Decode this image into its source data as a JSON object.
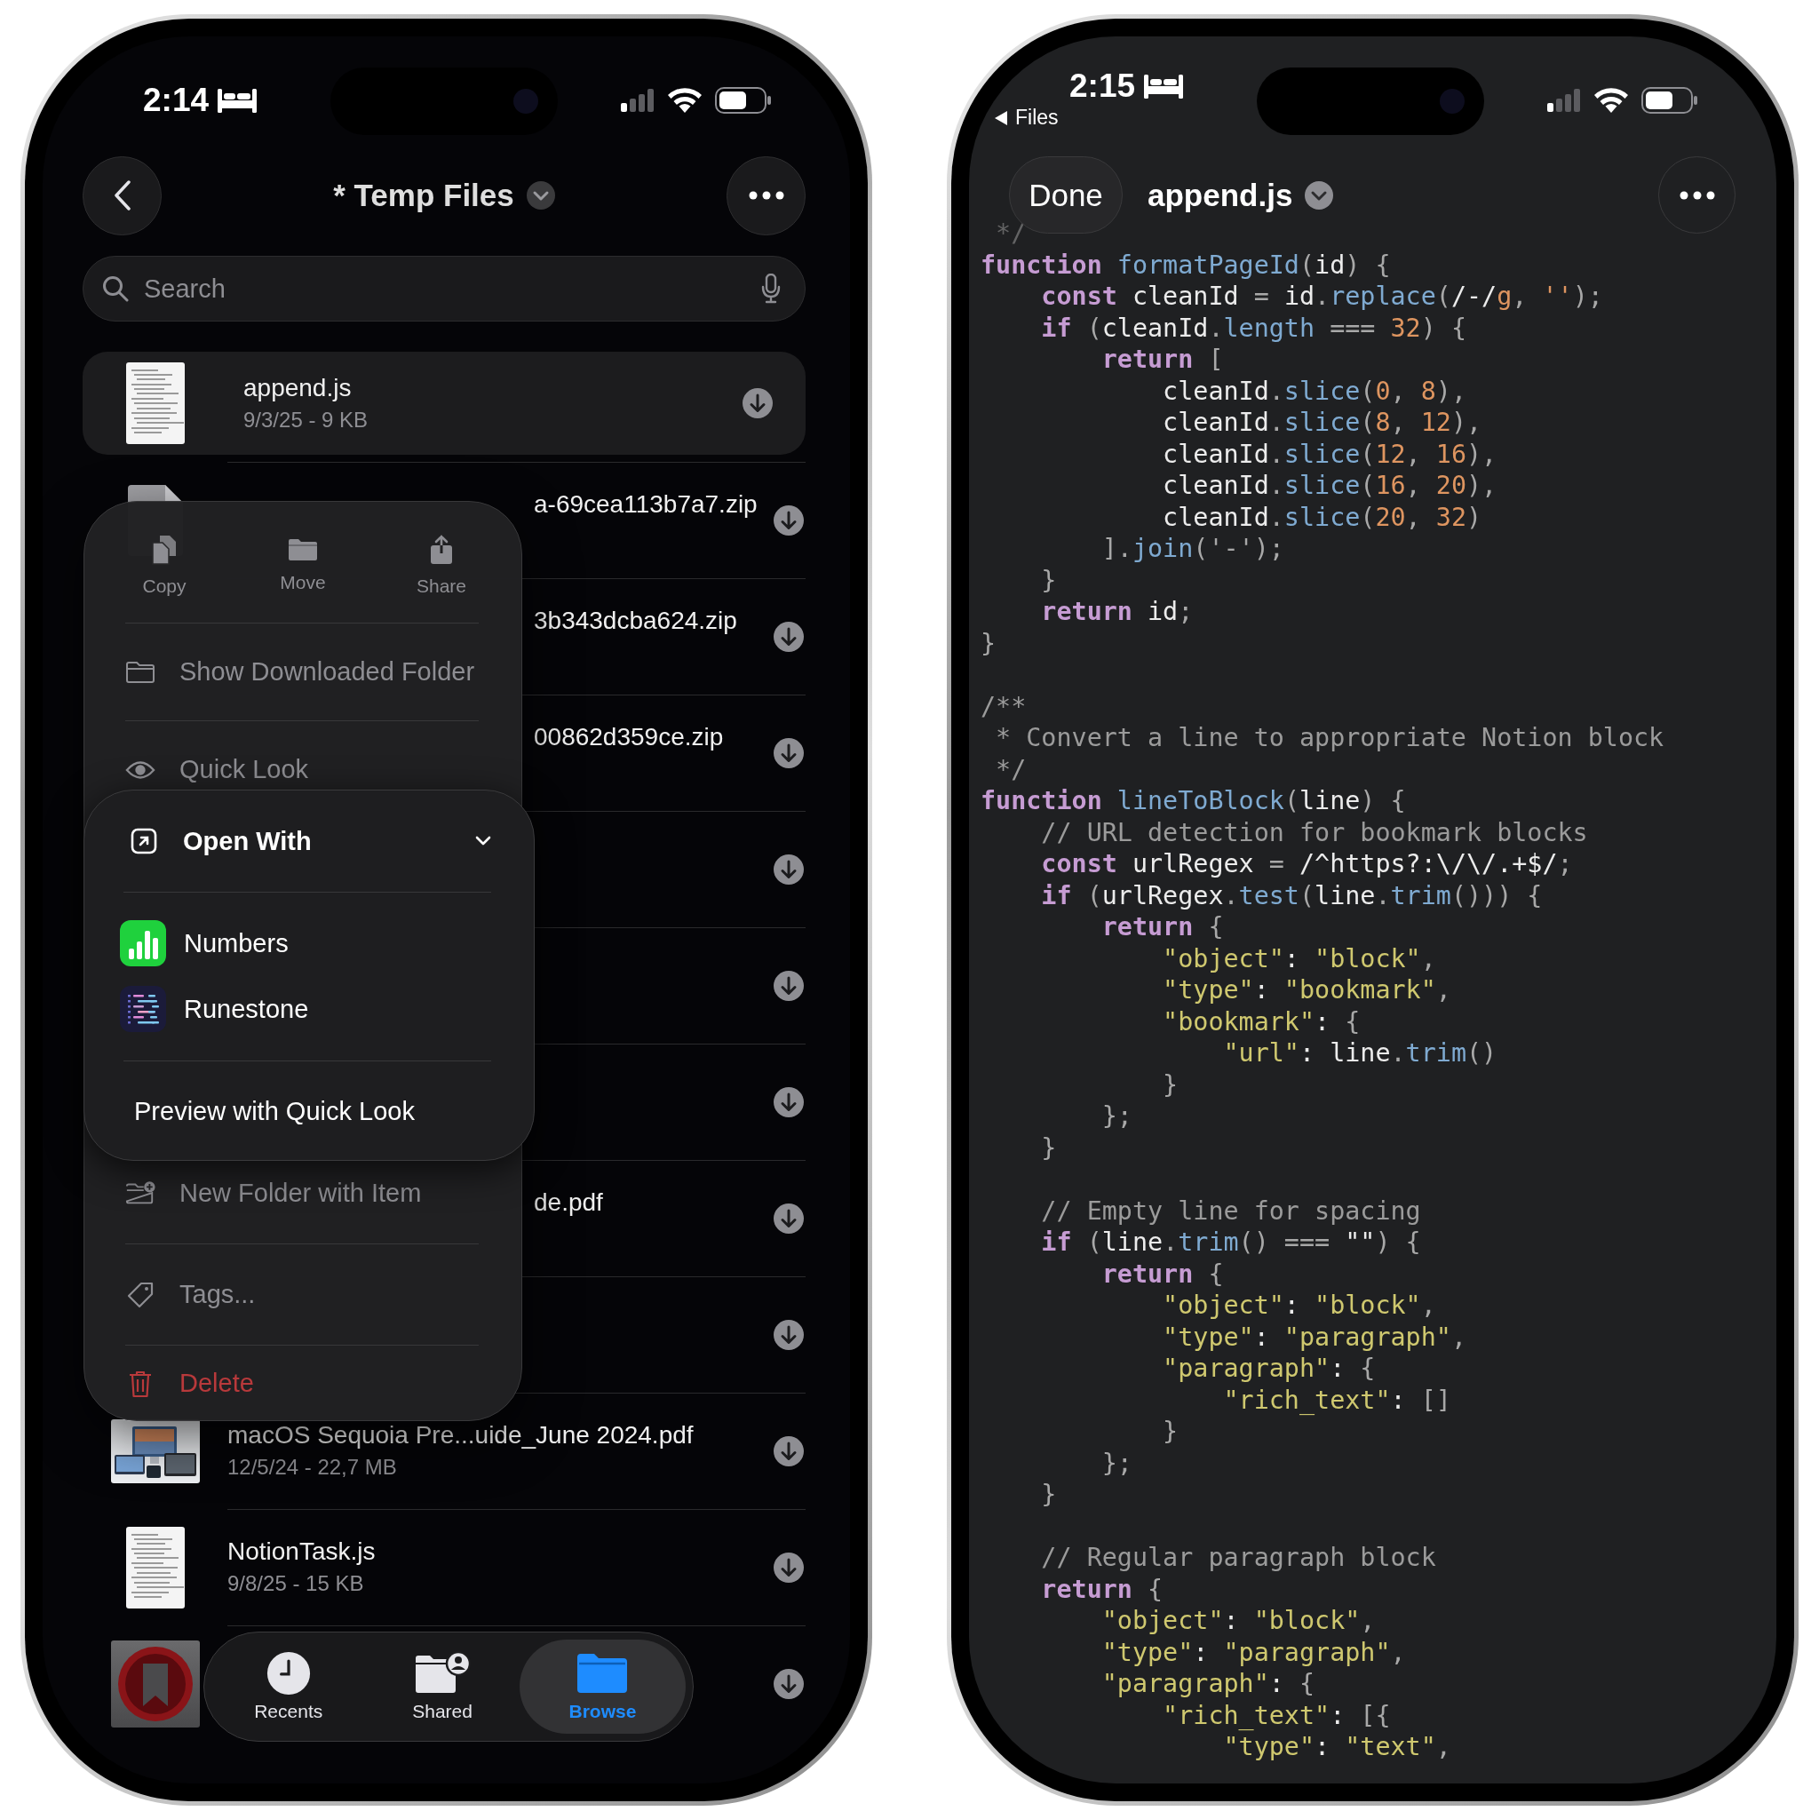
{
  "files_phone": {
    "status_bar": {
      "time": "2:14"
    },
    "title": "* Temp Files",
    "search": {
      "placeholder": "Search"
    },
    "rows": [
      {
        "kind": "document",
        "name": "append.js",
        "meta": "9/3/25 - 9 KB",
        "selected": true
      },
      {
        "kind": "zip",
        "name": "a-69cea113b7a7.zip",
        "selected": false
      },
      {
        "kind": "none",
        "name": "3b343dcba624.zip",
        "selected": false
      },
      {
        "kind": "none",
        "name": "00862d359ce.zip",
        "selected": false
      },
      {
        "kind": "none",
        "selected": false
      },
      {
        "kind": "none",
        "selected": false
      },
      {
        "kind": "none",
        "selected": false
      },
      {
        "kind": "none",
        "name": "de.pdf",
        "selected": false
      },
      {
        "kind": "none",
        "selected": false
      },
      {
        "kind": "picture",
        "name": "macOS Sequoia Pre...uide_June 2024.pdf",
        "meta": "12/5/24 - 22,7 MB",
        "selected": false
      },
      {
        "kind": "document",
        "name": "NotionTask.js",
        "meta": "9/8/25 - 15 KB",
        "selected": false
      },
      {
        "kind": "bookmark",
        "selected": false
      }
    ],
    "context_menu": {
      "actions": [
        {
          "label": "Copy"
        },
        {
          "label": "Move"
        },
        {
          "label": "Share"
        }
      ],
      "items": [
        {
          "kind": "item",
          "label": "Show Downloaded Folder"
        },
        {
          "kind": "item",
          "label": "Quick Look"
        },
        {
          "kind": "submenu",
          "label": "Open With",
          "expanded": true,
          "apps": [
            {
              "name": "Numbers"
            },
            {
              "name": "Runestone"
            }
          ],
          "footer": "Preview with Quick Look"
        },
        {
          "kind": "item",
          "label": "New Folder with Item"
        },
        {
          "kind": "item",
          "label": "Tags..."
        },
        {
          "kind": "destructive",
          "label": "Delete"
        }
      ]
    },
    "tab_bar": [
      {
        "label": "Recents",
        "selected": false
      },
      {
        "label": "Shared",
        "selected": false
      },
      {
        "label": "Browse",
        "selected": true
      }
    ]
  },
  "editor_phone": {
    "status_bar": {
      "time": "2:15"
    },
    "back_label": "Files",
    "done_label": "Done",
    "title": "append.js",
    "code": [
      {
        "kind": "code",
        "tokens": [
          {
            "kind": "c",
            "text": " */"
          }
        ]
      },
      {
        "kind": "code",
        "tokens": [
          {
            "kind": "k",
            "text": "function"
          },
          {
            "kind": "f",
            "text": " formatPageId"
          },
          {
            "kind": "p",
            "text": "("
          },
          {
            "kind": "i",
            "text": "id"
          },
          {
            "kind": "p",
            "text": ") {"
          }
        ]
      },
      {
        "kind": "code",
        "tokens": [
          {
            "kind": "k",
            "text": "    const"
          },
          {
            "kind": "i",
            "text": " cleanId "
          },
          {
            "kind": "p",
            "text": "= "
          },
          {
            "kind": "i",
            "text": "id"
          },
          {
            "kind": "p",
            "text": "."
          },
          {
            "kind": "f",
            "text": "replace"
          },
          {
            "kind": "p",
            "text": "("
          },
          {
            "kind": "i",
            "text": "/-/"
          },
          {
            "kind": "n",
            "text": "g"
          },
          {
            "kind": "p",
            "text": ", "
          },
          {
            "kind": "n",
            "text": "''"
          },
          {
            "kind": "p",
            "text": ");"
          }
        ]
      },
      {
        "kind": "code",
        "tokens": [
          {
            "kind": "k",
            "text": "    if"
          },
          {
            "kind": "p",
            "text": " ("
          },
          {
            "kind": "i",
            "text": "cleanId"
          },
          {
            "kind": "p",
            "text": "."
          },
          {
            "kind": "f",
            "text": "length"
          },
          {
            "kind": "p",
            "text": " === "
          },
          {
            "kind": "n",
            "text": "32"
          },
          {
            "kind": "p",
            "text": ") {"
          }
        ]
      },
      {
        "kind": "code",
        "tokens": [
          {
            "kind": "k",
            "text": "        return"
          },
          {
            "kind": "p",
            "text": " ["
          }
        ]
      },
      {
        "kind": "code",
        "tokens": [
          {
            "kind": "i",
            "text": "            cleanId"
          },
          {
            "kind": "p",
            "text": "."
          },
          {
            "kind": "f",
            "text": "slice"
          },
          {
            "kind": "p",
            "text": "("
          },
          {
            "kind": "n",
            "text": "0"
          },
          {
            "kind": "p",
            "text": ", "
          },
          {
            "kind": "n",
            "text": "8"
          },
          {
            "kind": "p",
            "text": "),"
          }
        ]
      },
      {
        "kind": "code",
        "tokens": [
          {
            "kind": "i",
            "text": "            cleanId"
          },
          {
            "kind": "p",
            "text": "."
          },
          {
            "kind": "f",
            "text": "slice"
          },
          {
            "kind": "p",
            "text": "("
          },
          {
            "kind": "n",
            "text": "8"
          },
          {
            "kind": "p",
            "text": ", "
          },
          {
            "kind": "n",
            "text": "12"
          },
          {
            "kind": "p",
            "text": "),"
          }
        ]
      },
      {
        "kind": "code",
        "tokens": [
          {
            "kind": "i",
            "text": "            cleanId"
          },
          {
            "kind": "p",
            "text": "."
          },
          {
            "kind": "f",
            "text": "slice"
          },
          {
            "kind": "p",
            "text": "("
          },
          {
            "kind": "n",
            "text": "12"
          },
          {
            "kind": "p",
            "text": ", "
          },
          {
            "kind": "n",
            "text": "16"
          },
          {
            "kind": "p",
            "text": "),"
          }
        ]
      },
      {
        "kind": "code",
        "tokens": [
          {
            "kind": "i",
            "text": "            cleanId"
          },
          {
            "kind": "p",
            "text": "."
          },
          {
            "kind": "f",
            "text": "slice"
          },
          {
            "kind": "p",
            "text": "("
          },
          {
            "kind": "n",
            "text": "16"
          },
          {
            "kind": "p",
            "text": ", "
          },
          {
            "kind": "n",
            "text": "20"
          },
          {
            "kind": "p",
            "text": "),"
          }
        ]
      },
      {
        "kind": "code",
        "tokens": [
          {
            "kind": "i",
            "text": "            cleanId"
          },
          {
            "kind": "p",
            "text": "."
          },
          {
            "kind": "f",
            "text": "slice"
          },
          {
            "kind": "p",
            "text": "("
          },
          {
            "kind": "n",
            "text": "20"
          },
          {
            "kind": "p",
            "text": ", "
          },
          {
            "kind": "n",
            "text": "32"
          },
          {
            "kind": "p",
            "text": ")"
          }
        ]
      },
      {
        "kind": "code",
        "tokens": [
          {
            "kind": "p",
            "text": "        ]."
          },
          {
            "kind": "f",
            "text": "join"
          },
          {
            "kind": "p",
            "text": "('-');"
          }
        ]
      },
      {
        "kind": "code",
        "tokens": [
          {
            "kind": "p",
            "text": "    }"
          }
        ]
      },
      {
        "kind": "code",
        "tokens": [
          {
            "kind": "k",
            "text": "    return"
          },
          {
            "kind": "i",
            "text": " id"
          },
          {
            "kind": "p",
            "text": ";"
          }
        ]
      },
      {
        "kind": "code",
        "tokens": [
          {
            "kind": "p",
            "text": "}"
          }
        ]
      },
      {
        "kind": "blank"
      },
      {
        "kind": "code",
        "tokens": [
          {
            "kind": "c",
            "text": "/**"
          }
        ]
      },
      {
        "kind": "code",
        "tokens": [
          {
            "kind": "c",
            "text": " * Convert a line to appropriate Notion block"
          }
        ]
      },
      {
        "kind": "code",
        "tokens": [
          {
            "kind": "c",
            "text": " */"
          }
        ]
      },
      {
        "kind": "code",
        "tokens": [
          {
            "kind": "k",
            "text": "function"
          },
          {
            "kind": "f",
            "text": " lineToBlock"
          },
          {
            "kind": "p",
            "text": "("
          },
          {
            "kind": "i",
            "text": "line"
          },
          {
            "kind": "p",
            "text": ") {"
          }
        ]
      },
      {
        "kind": "code",
        "tokens": [
          {
            "kind": "c",
            "text": "    // URL detection for bookmark blocks"
          }
        ]
      },
      {
        "kind": "code",
        "tokens": [
          {
            "kind": "k",
            "text": "    const"
          },
          {
            "kind": "i",
            "text": " urlRegex "
          },
          {
            "kind": "p",
            "text": "= "
          },
          {
            "kind": "i",
            "text": "/^https?:\\/\\/.+$/"
          },
          {
            "kind": "p",
            "text": ";"
          }
        ]
      },
      {
        "kind": "code",
        "tokens": [
          {
            "kind": "k",
            "text": "    if"
          },
          {
            "kind": "p",
            "text": " ("
          },
          {
            "kind": "i",
            "text": "urlRegex"
          },
          {
            "kind": "p",
            "text": "."
          },
          {
            "kind": "f",
            "text": "test"
          },
          {
            "kind": "p",
            "text": "("
          },
          {
            "kind": "i",
            "text": "line"
          },
          {
            "kind": "p",
            "text": "."
          },
          {
            "kind": "f",
            "text": "trim"
          },
          {
            "kind": "p",
            "text": "())) {"
          }
        ]
      },
      {
        "kind": "code",
        "tokens": [
          {
            "kind": "k",
            "text": "        return"
          },
          {
            "kind": "p",
            "text": " {"
          }
        ]
      },
      {
        "kind": "code",
        "tokens": [
          {
            "kind": "s",
            "text": "            \"object\""
          },
          {
            "kind": "i",
            "text": ": "
          },
          {
            "kind": "s",
            "text": "\"block\""
          },
          {
            "kind": "p",
            "text": ","
          }
        ]
      },
      {
        "kind": "code",
        "tokens": [
          {
            "kind": "s",
            "text": "            \"type\""
          },
          {
            "kind": "i",
            "text": ": "
          },
          {
            "kind": "s",
            "text": "\"bookmark\""
          },
          {
            "kind": "p",
            "text": ","
          }
        ]
      },
      {
        "kind": "code",
        "tokens": [
          {
            "kind": "s",
            "text": "            \"bookmark\""
          },
          {
            "kind": "i",
            "text": ": "
          },
          {
            "kind": "p",
            "text": "{"
          }
        ]
      },
      {
        "kind": "code",
        "tokens": [
          {
            "kind": "s",
            "text": "                \"url\""
          },
          {
            "kind": "i",
            "text": ": line"
          },
          {
            "kind": "p",
            "text": "."
          },
          {
            "kind": "f",
            "text": "trim"
          },
          {
            "kind": "p",
            "text": "()"
          }
        ]
      },
      {
        "kind": "code",
        "tokens": [
          {
            "kind": "p",
            "text": "            }"
          }
        ]
      },
      {
        "kind": "code",
        "tokens": [
          {
            "kind": "p",
            "text": "        };"
          }
        ]
      },
      {
        "kind": "code",
        "tokens": [
          {
            "kind": "p",
            "text": "    }"
          }
        ]
      },
      {
        "kind": "blank"
      },
      {
        "kind": "code",
        "tokens": [
          {
            "kind": "c",
            "text": "    // Empty line for spacing"
          }
        ]
      },
      {
        "kind": "code",
        "tokens": [
          {
            "kind": "k",
            "text": "    if"
          },
          {
            "kind": "p",
            "text": " ("
          },
          {
            "kind": "i",
            "text": "line"
          },
          {
            "kind": "p",
            "text": "."
          },
          {
            "kind": "f",
            "text": "trim"
          },
          {
            "kind": "p",
            "text": "() === "
          },
          {
            "kind": "i",
            "text": "\"\""
          },
          {
            "kind": "p",
            "text": ") {"
          }
        ]
      },
      {
        "kind": "code",
        "tokens": [
          {
            "kind": "k",
            "text": "        return"
          },
          {
            "kind": "p",
            "text": " {"
          }
        ]
      },
      {
        "kind": "code",
        "tokens": [
          {
            "kind": "s",
            "text": "            \"object\""
          },
          {
            "kind": "i",
            "text": ": "
          },
          {
            "kind": "s",
            "text": "\"block\""
          },
          {
            "kind": "p",
            "text": ","
          }
        ]
      },
      {
        "kind": "code",
        "tokens": [
          {
            "kind": "s",
            "text": "            \"type\""
          },
          {
            "kind": "i",
            "text": ": "
          },
          {
            "kind": "s",
            "text": "\"paragraph\""
          },
          {
            "kind": "p",
            "text": ","
          }
        ]
      },
      {
        "kind": "code",
        "tokens": [
          {
            "kind": "s",
            "text": "            \"paragraph\""
          },
          {
            "kind": "i",
            "text": ": "
          },
          {
            "kind": "p",
            "text": "{"
          }
        ]
      },
      {
        "kind": "code",
        "tokens": [
          {
            "kind": "s",
            "text": "                \"rich_text\""
          },
          {
            "kind": "i",
            "text": ": "
          },
          {
            "kind": "p",
            "text": "[]"
          }
        ]
      },
      {
        "kind": "code",
        "tokens": [
          {
            "kind": "p",
            "text": "            }"
          }
        ]
      },
      {
        "kind": "code",
        "tokens": [
          {
            "kind": "p",
            "text": "        };"
          }
        ]
      },
      {
        "kind": "code",
        "tokens": [
          {
            "kind": "p",
            "text": "    }"
          }
        ]
      },
      {
        "kind": "blank"
      },
      {
        "kind": "code",
        "tokens": [
          {
            "kind": "c",
            "text": "    // Regular paragraph block"
          }
        ]
      },
      {
        "kind": "code",
        "tokens": [
          {
            "kind": "k",
            "text": "    return"
          },
          {
            "kind": "p",
            "text": " {"
          }
        ]
      },
      {
        "kind": "code",
        "tokens": [
          {
            "kind": "s",
            "text": "        \"object\""
          },
          {
            "kind": "i",
            "text": ": "
          },
          {
            "kind": "s",
            "text": "\"block\""
          },
          {
            "kind": "p",
            "text": ","
          }
        ]
      },
      {
        "kind": "code",
        "tokens": [
          {
            "kind": "s",
            "text": "        \"type\""
          },
          {
            "kind": "i",
            "text": ": "
          },
          {
            "kind": "s",
            "text": "\"paragraph\""
          },
          {
            "kind": "p",
            "text": ","
          }
        ]
      },
      {
        "kind": "code",
        "tokens": [
          {
            "kind": "s",
            "text": "        \"paragraph\""
          },
          {
            "kind": "i",
            "text": ": "
          },
          {
            "kind": "p",
            "text": "{"
          }
        ]
      },
      {
        "kind": "code",
        "tokens": [
          {
            "kind": "s",
            "text": "            \"rich_text\""
          },
          {
            "kind": "i",
            "text": ": "
          },
          {
            "kind": "p",
            "text": "[{"
          }
        ]
      },
      {
        "kind": "code",
        "tokens": [
          {
            "kind": "s",
            "text": "                \"type\""
          },
          {
            "kind": "i",
            "text": ": "
          },
          {
            "kind": "s",
            "text": "\"text\""
          },
          {
            "kind": "p",
            "text": ","
          }
        ]
      }
    ]
  }
}
